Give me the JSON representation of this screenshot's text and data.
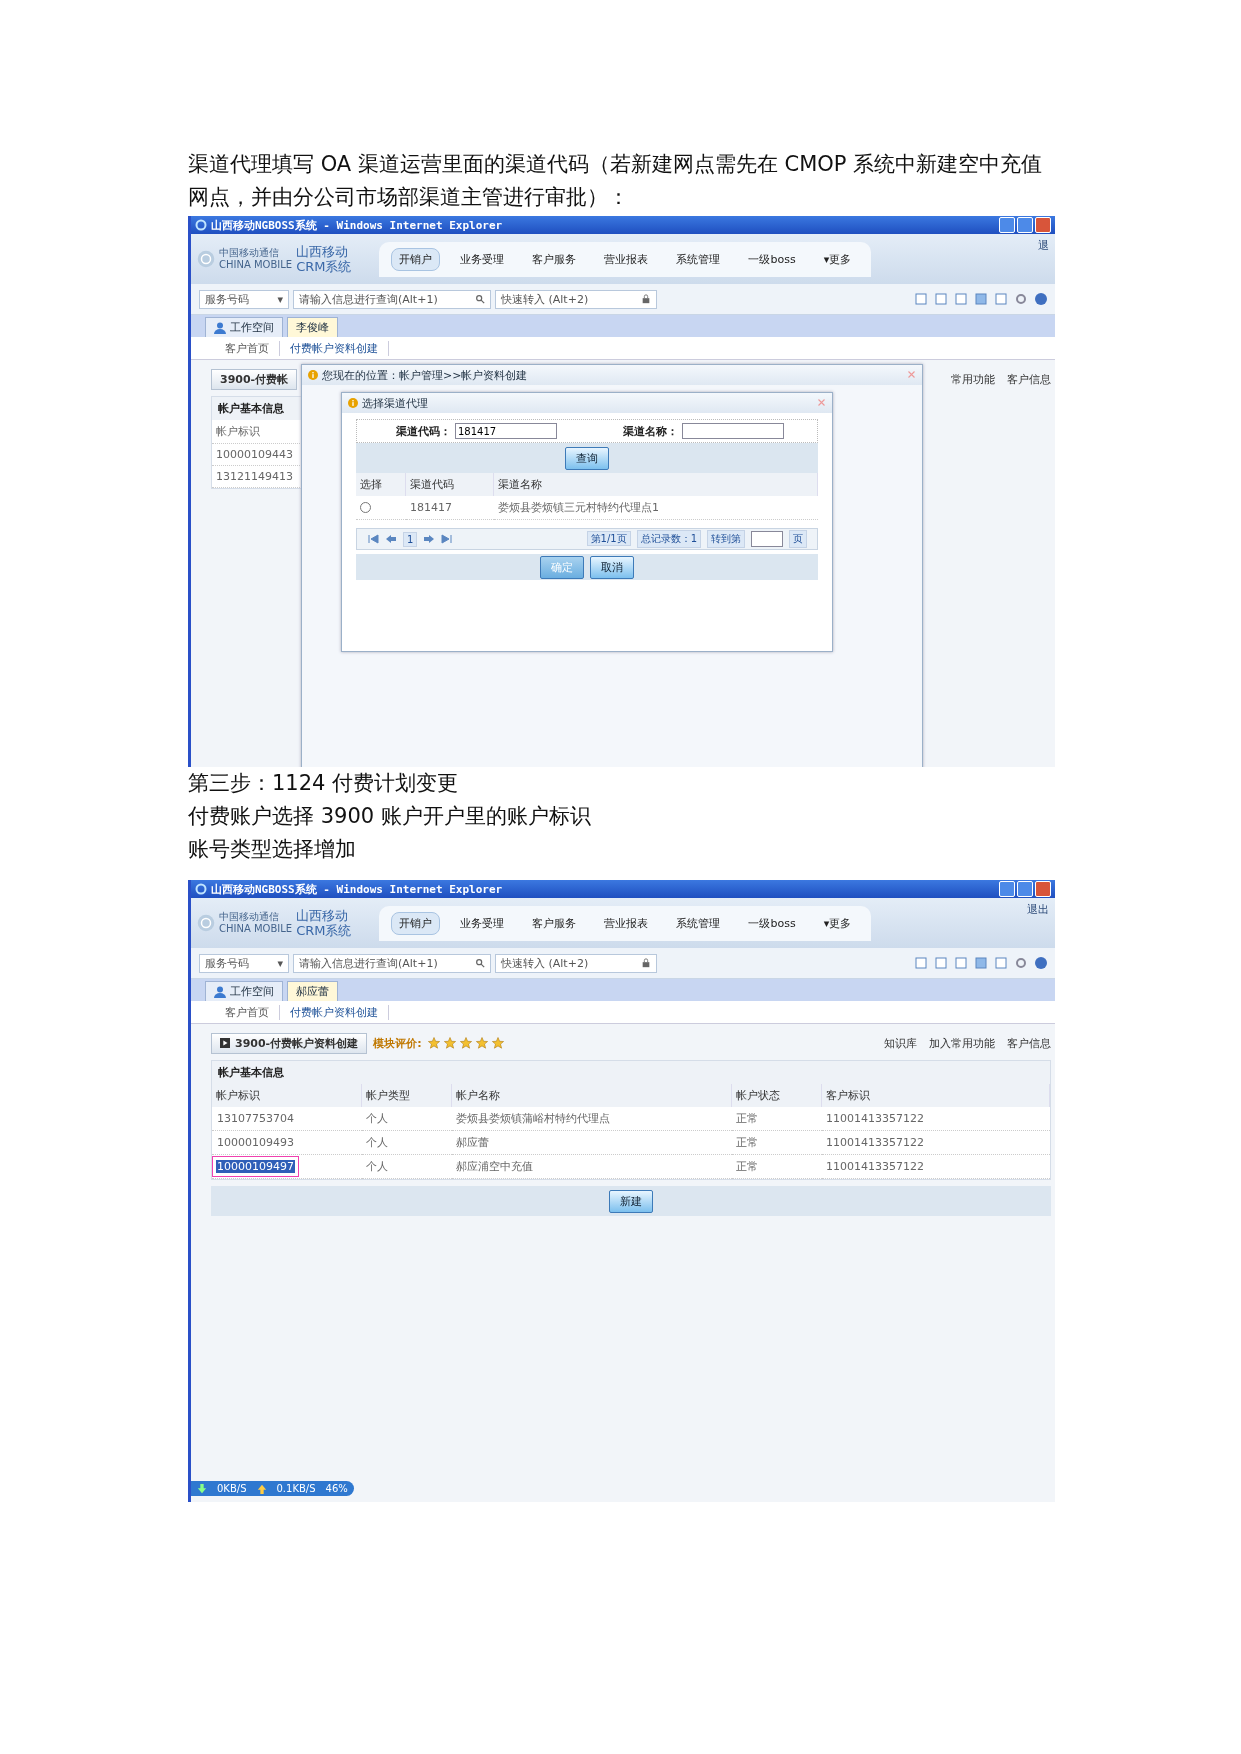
{
  "paragraph_1": "渠道代理填写 OA 渠道运营里面的渠道代码（若新建网点需先在 CMOP 系统中新建空中充值网点，并由分公司市场部渠道主管进行审批）：",
  "screenshot_1": {
    "window_title": "山西移动NGBOSS系统 - Windows Internet Explorer",
    "brand": {
      "company": "中国移动通信",
      "company_en": "CHINA MOBILE",
      "name_1": "山西移动",
      "name_2": "CRM系统"
    },
    "logout": "退",
    "nav": [
      {
        "label": "开销户",
        "selected": true
      },
      {
        "label": "业务受理",
        "selected": false
      },
      {
        "label": "客户服务",
        "selected": false
      },
      {
        "label": "营业报表",
        "selected": false
      },
      {
        "label": "系统管理",
        "selected": false
      },
      {
        "label": "一级boss",
        "selected": false
      },
      {
        "label": "▾更多",
        "selected": false
      }
    ],
    "search": {
      "type": "服务号码",
      "caret": "▾",
      "placeholder": "请输入信息进行查询(Alt+1)",
      "quick": "快速转入 (Alt+2)"
    },
    "tabs": [
      {
        "label": "工作空间",
        "selected": false,
        "kind": "home"
      },
      {
        "label": "李俊峰",
        "selected": true,
        "kind": "customer"
      }
    ],
    "subtabs": [
      {
        "label": "客户首页",
        "selected": false
      },
      {
        "label": "付费帐户资料创建",
        "selected": true
      }
    ],
    "module_title": "3900-付费帐",
    "links": [
      "常用功能",
      "客户信息"
    ],
    "section": "帐户基本信息",
    "column": "帐户标识",
    "rows": [
      "10000109443",
      "13121149413"
    ],
    "outer_dialog": "您现在的位置：帐户管理>>帐户资料创建",
    "inner_dialog": {
      "title": "选择渠道代理",
      "code_label": "渠道代码：",
      "code_value": "181417",
      "name_label": "渠道名称：",
      "query": "查询",
      "columns": [
        "选择",
        "渠道代码",
        "渠道名称"
      ],
      "rows": [
        {
          "selected": false,
          "code": "181417",
          "name": "娄烦县娄烦镇三元村特约代理点1"
        }
      ],
      "page": "1",
      "page_info": "第1/1页",
      "total": "总记录数：1",
      "goto": "转到第",
      "goto_unit": "页",
      "ok": {
        "label": "确定",
        "disabled": true
      },
      "cancel": {
        "label": "取消",
        "disabled": false
      }
    }
  },
  "paragraph_2": "第三步：1124 付费计划变更",
  "paragraph_3": "付费账户选择 3900 账户开户里的账户标识",
  "paragraph_4": "账号类型选择增加",
  "screenshot_2": {
    "window_title": "山西移动NGBOSS系统 - Windows Internet Explorer",
    "brand": {
      "company": "中国移动通信",
      "company_en": "CHINA MOBILE",
      "name_1": "山西移动",
      "name_2": "CRM系统"
    },
    "logout": "退出",
    "nav": [
      {
        "label": "开销户",
        "selected": true
      },
      {
        "label": "业务受理",
        "selected": false
      },
      {
        "label": "客户服务",
        "selected": false
      },
      {
        "label": "营业报表",
        "selected": false
      },
      {
        "label": "系统管理",
        "selected": false
      },
      {
        "label": "一级boss",
        "selected": false
      },
      {
        "label": "▾更多",
        "selected": false
      }
    ],
    "search": {
      "type": "服务号码",
      "caret": "▾",
      "placeholder": "请输入信息进行查询(Alt+1)",
      "quick": "快速转入 (Alt+2)"
    },
    "tabs": [
      {
        "label": "工作空间",
        "selected": false,
        "kind": "home"
      },
      {
        "label": "郝应蕾",
        "selected": true,
        "kind": "customer"
      }
    ],
    "subtabs": [
      {
        "label": "客户首页",
        "selected": false
      },
      {
        "label": "付费帐户资料创建",
        "selected": true
      }
    ],
    "module_title": "3900-付费帐户资料创建",
    "rating_label": "模块评价:",
    "stars": 5,
    "links": [
      "知识库",
      "加入常用功能",
      "客户信息"
    ],
    "section": "帐户基本信息",
    "columns": [
      "帐户标识",
      "帐户类型",
      "帐户名称",
      "帐户状态",
      "客户标识"
    ],
    "rows": [
      {
        "selected": false,
        "cells": [
          "13107753704",
          "个人",
          "娄烦县娄烦镇蒲峪村特约代理点",
          "正常",
          "11001413357122"
        ]
      },
      {
        "selected": false,
        "cells": [
          "10000109493",
          "个人",
          "郝应蕾",
          "正常",
          "11001413357122"
        ]
      },
      {
        "selected": true,
        "cells": [
          "10000109497",
          "个人",
          "郝应浦空中充值",
          "正常",
          "11001413357122"
        ]
      }
    ],
    "new_button": "新建",
    "status": {
      "down": "0KB/S",
      "up": "0.1KB/S",
      "percent": "46%"
    }
  }
}
